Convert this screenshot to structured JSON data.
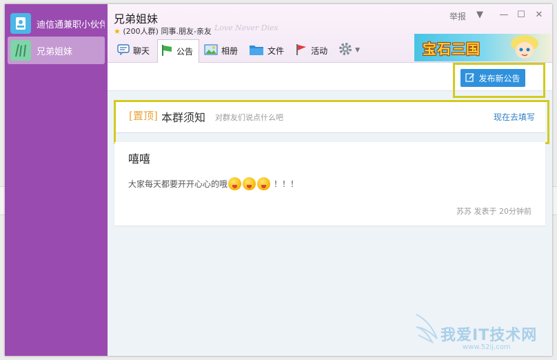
{
  "sidebar": {
    "items": [
      {
        "label": "迪信通兼职小伙伴"
      },
      {
        "label": "兄弟姐妹"
      }
    ]
  },
  "header": {
    "group_name": "兄弟姐妹",
    "group_sub": "(200人群) 同事.朋友-亲友",
    "report_label": "举报",
    "watermark_script": "Love Never Dies"
  },
  "tabs": [
    {
      "label": "聊天",
      "icon": "chat-icon"
    },
    {
      "label": "公告",
      "icon": "flag-icon"
    },
    {
      "label": "相册",
      "icon": "photo-icon"
    },
    {
      "label": "文件",
      "icon": "folder-icon"
    },
    {
      "label": "活动",
      "icon": "red-flag-icon"
    }
  ],
  "banner": {
    "text": "宝石三国"
  },
  "toolbar": {
    "publish_label": "发布新公告"
  },
  "pinned": {
    "tag": "[置顶]",
    "title": "本群须知",
    "hint": "对群友们说点什么吧",
    "action": "现在去填写"
  },
  "post": {
    "title": "嘻嘻",
    "body": "大家每天都要开开心心的哦",
    "body_suffix": "！！！",
    "meta": "苏苏 发表于 20分钟前"
  },
  "site_watermark": {
    "title": "我爱IT技术网",
    "url": "www.52ij.com"
  },
  "colors": {
    "sidebar": "#9a4bb0",
    "accent_button": "#2f91dc",
    "highlight": "#d2cb1e",
    "pin_tag": "#e9a43a",
    "link": "#2b7fc5"
  }
}
